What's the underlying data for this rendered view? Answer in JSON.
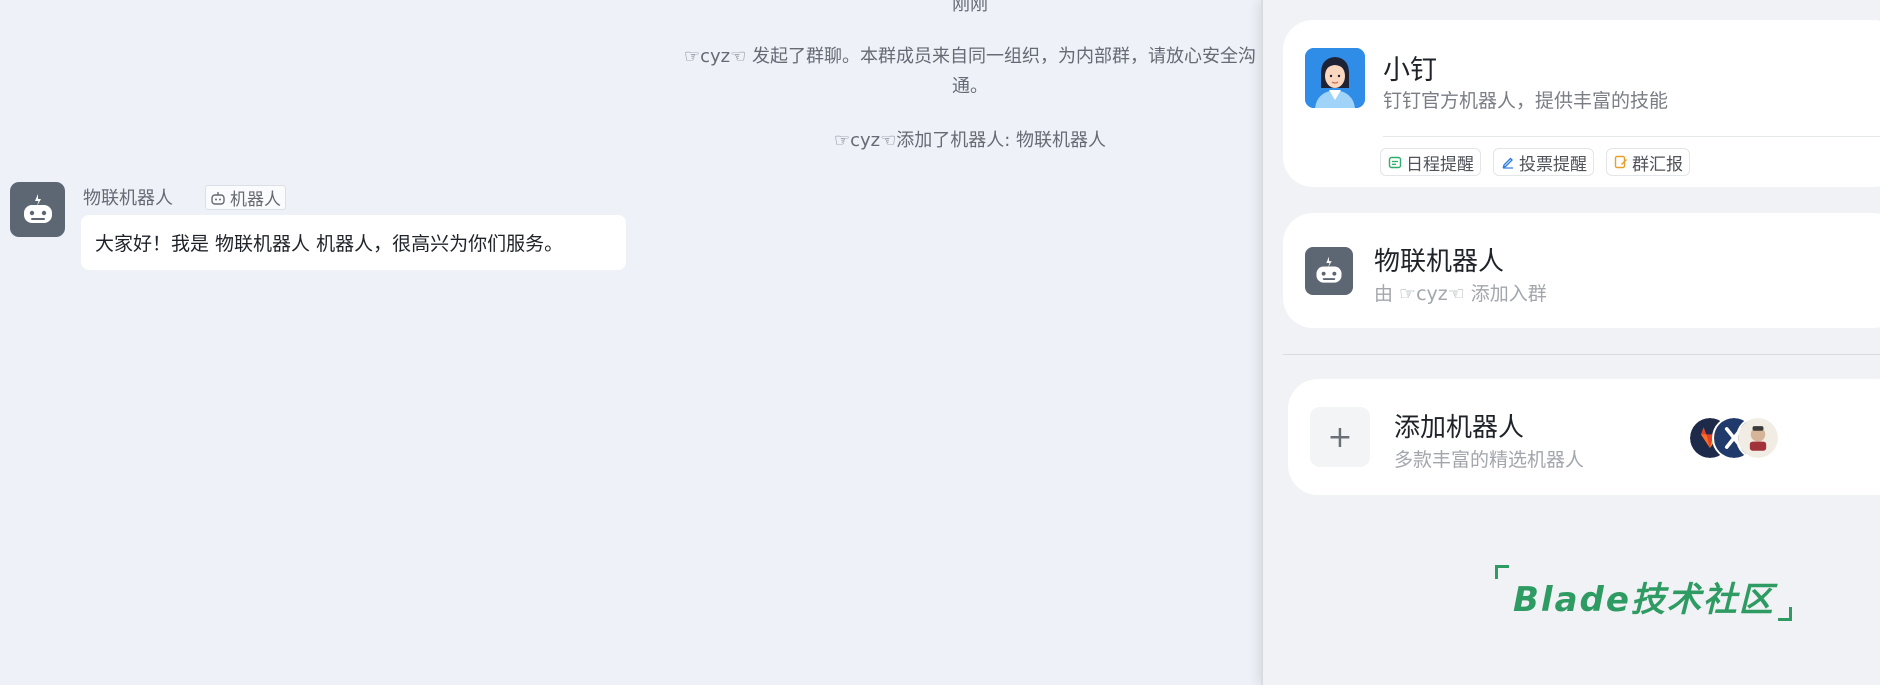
{
  "chat": {
    "time": "刚刚",
    "system_messages": [
      "☞cyz☜ 发起了群聊。本群成员来自同一组织，为内部群，请放心安全沟通。",
      "☞cyz☜添加了机器人: 物联机器人"
    ],
    "message": {
      "sender": "物联机器人",
      "tag": "机器人",
      "text": "大家好！我是 物联机器人 机器人，很高兴为你们服务。"
    }
  },
  "panel": {
    "xiaoding": {
      "title": "小钉",
      "desc": "钉钉官方机器人，提供丰富的技能",
      "chips": [
        {
          "label": "日程提醒",
          "icon": "calendar-icon",
          "color": "#2eae6b"
        },
        {
          "label": "投票提醒",
          "icon": "pen-icon",
          "color": "#2f7be0"
        },
        {
          "label": "群汇报",
          "icon": "edit-doc-icon",
          "color": "#e8a02c"
        }
      ]
    },
    "iot": {
      "title": "物联机器人",
      "subtitle": "由 ☞cyz☜ 添加入群"
    },
    "add_robot": {
      "title": "添加机器人",
      "subtitle": "多款丰富的精选机器人",
      "logos": [
        "gitlab-logo",
        "jira-logo",
        "jenkins-logo"
      ]
    }
  },
  "watermark": "Blade技术社区",
  "colors": {
    "background": "#eef1f8",
    "robot_avatar": "#5d6774",
    "accent_green": "#2e9b62"
  }
}
